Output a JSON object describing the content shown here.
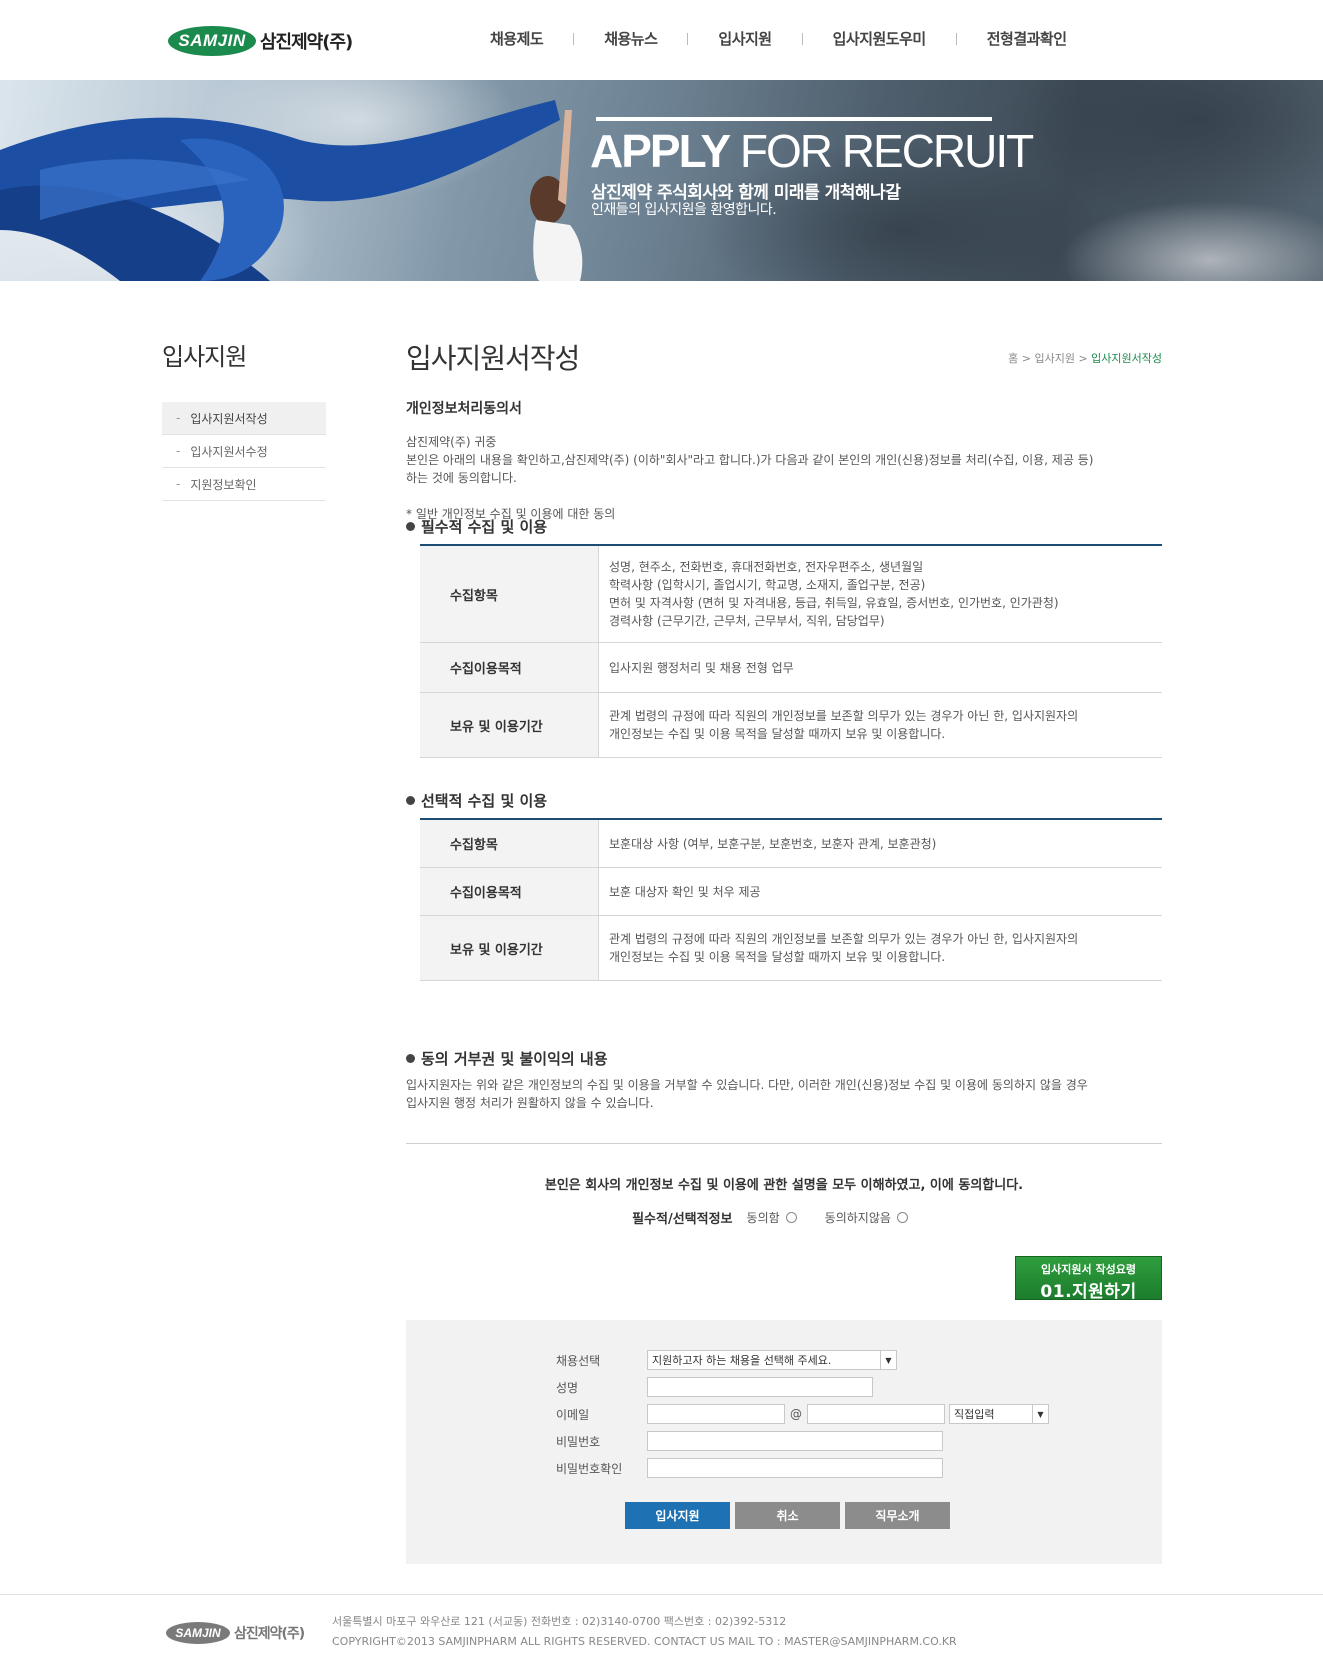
{
  "header": {
    "logo_mark": "SAMJIN",
    "logo_text": "삼진제약(주)",
    "nav": [
      "채용제도",
      "채용뉴스",
      "입사지원",
      "입사지원도우미",
      "전형결과확인"
    ]
  },
  "banner": {
    "title_bold": "APPLY",
    "title_light": "FOR RECRUIT",
    "subtitle1": "삼진제약 주식회사와 함께 미래를 개척해나갈",
    "subtitle2": "인재들의 입사지원을 환영합니다."
  },
  "sidebar": {
    "title": "입사지원",
    "items": [
      {
        "label": "입사지원서작성",
        "active": true
      },
      {
        "label": "입사지원서수정",
        "active": false
      },
      {
        "label": "지원정보확인",
        "active": false
      }
    ]
  },
  "content": {
    "page_title": "입사지원서작성",
    "breadcrumb": {
      "home": "홈",
      "sep": ">",
      "level1": "입사지원",
      "current": "입사지원서작성"
    },
    "section_title": "개인정보처리동의서",
    "intro_lines": [
      "삼진제약(주) 귀중",
      "본인은 아래의 내용을 확인하고,삼진제약(주) (이하\"회사\"라고 합니다.)가 다음과 같이 본인의 개인(신용)정보를 처리(수집, 이용, 제공 등)",
      "하는 것에 동의합니다."
    ],
    "note": "* 일반 개인정보 수집 및 이용에 대한 동의",
    "required": {
      "title": "필수적 수집 및 이용",
      "rows": [
        {
          "header": "수집항목",
          "lines": [
            "성명, 현주소, 전화번호, 휴대전화번호, 전자우편주소, 생년월일",
            "학력사항 (입학시기, 졸업시기, 학교명, 소재지, 졸업구분, 전공)",
            "면허 및 자격사항 (면허 및 자격내용, 등급, 취득일, 유효일, 증서번호, 인가번호, 인가관청)",
            "경력사항 (근무기간, 근무처, 근무부서, 직위, 담당업무)"
          ]
        },
        {
          "header": "수집이용목적",
          "lines": [
            "입사지원 행정처리 및 채용 전형 업무"
          ]
        },
        {
          "header": "보유 및 이용기간",
          "lines": [
            "관계 법령의 규정에 따라 직원의 개인정보를 보존할 의무가 있는 경우가 아닌 한, 입사지원자의",
            "개인정보는 수집 및 이용 목적을 달성할 때까지 보유 및 이용합니다."
          ]
        }
      ]
    },
    "optional": {
      "title": "선택적 수집 및 이용",
      "rows": [
        {
          "header": "수집항목",
          "lines": [
            "보훈대상 사항 (여부, 보훈구분, 보훈번호, 보훈자 관계, 보훈관청)"
          ]
        },
        {
          "header": "수집이용목적",
          "lines": [
            "보훈 대상자 확인 및 처우 제공"
          ]
        },
        {
          "header": "보유 및 이용기간",
          "lines": [
            "관계 법령의 규정에 따라 직원의 개인정보를 보존할 의무가 있는 경우가 아닌 한, 입사지원자의",
            "개인정보는 수집 및 이용 목적을 달성할 때까지 보유 및 이용합니다."
          ]
        }
      ]
    },
    "refuse": {
      "title": "동의 거부권 및 불이익의 내용",
      "lines": [
        "입사지원자는 위와 같은 개인정보의 수집 및 이용을 거부할 수 있습니다. 다만, 이러한 개인(신용)정보 수집 및 이용에 동의하지 않을 경우",
        "입사지원 행정 처리가 원활하지 않을 수 있습니다."
      ]
    },
    "agree": {
      "statement": "본인은 회사의 개인정보 수집 및 이용에 관한 설명을 모두 이해하였고, 이에 동의합니다.",
      "label": "필수적/선택적정보",
      "agree_option": "동의함",
      "disagree_option": "동의하지않음"
    },
    "guide_button": {
      "small": "입사지원서 작성요령",
      "big": "01.지원하기"
    }
  },
  "form": {
    "recruit_label": "채용선택",
    "recruit_select": "지원하고자 하는 채용을 선택해 주세요.",
    "name_label": "성명",
    "email_label": "이메일",
    "email_at": "@",
    "email_domain_select": "직접입력",
    "password_label": "비밀번호",
    "password_confirm_label": "비밀번호확인",
    "buttons": {
      "apply": "입사지원",
      "cancel": "취소",
      "job_intro": "직무소개"
    }
  },
  "footer": {
    "logo_mark": "SAMJIN",
    "logo_text": "삼진제약(주)",
    "address": "서울특별시 마포구 와우산로 121 (서교동)  전화번호 : 02)3140-0700   팩스번호 : 02)392-5312",
    "copyright": "COPYRIGHT©2013 SAMJINPHARM ALL RIGHTS RESERVED. CONTACT US MAIL TO : MASTER@SAMJINPHARM.CO.KR"
  },
  "colors": {
    "brand_green": "#1a8a4d",
    "table_top": "#1e4d74",
    "button_blue": "#1e72b4",
    "button_gray": "#8c8c8c"
  }
}
